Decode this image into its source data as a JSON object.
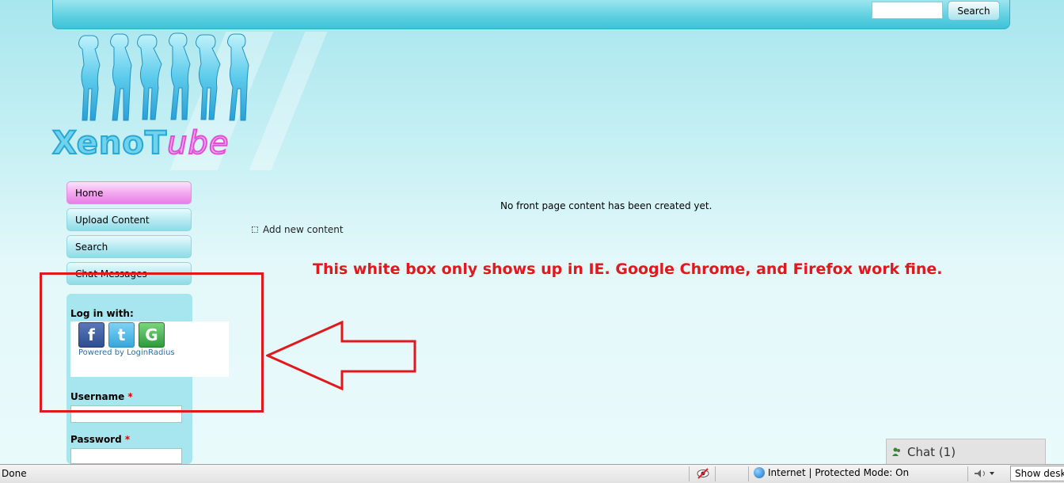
{
  "header": {
    "search_button_label": "Search",
    "search_input_value": ""
  },
  "logo": {
    "word_part1": "XenoT",
    "word_part2": "ube",
    "alt": "XenoTube"
  },
  "menu": {
    "items": [
      {
        "label": "Home",
        "active": true
      },
      {
        "label": "Upload Content",
        "active": false
      },
      {
        "label": "Search",
        "active": false
      },
      {
        "label": "Chat Messages",
        "active": false
      }
    ]
  },
  "login": {
    "heading": "Log in with:",
    "providers": [
      {
        "name": "facebook-icon",
        "glyph": "f",
        "color": "#3b5998"
      },
      {
        "name": "twitter-icon",
        "glyph": "t",
        "color": "#3aaae1"
      },
      {
        "name": "google-icon",
        "glyph": "G",
        "color": "#2e9b3a"
      }
    ],
    "powered_by": "Powered by LoginRadius",
    "username_label": "Username",
    "password_label": "Password",
    "required_marker": "*"
  },
  "content": {
    "front_message": "No front page content has been created yet.",
    "add_content_link": "Add new content"
  },
  "annotation": {
    "text": "This white box only shows up in IE. Google Chrome, and Firefox work fine.",
    "color": "#e1181e"
  },
  "chat": {
    "label": "Chat (1)"
  },
  "statusbar": {
    "status": "Done",
    "zone": "Internet | Protected Mode: On",
    "show_desktop": "Show desktop"
  }
}
